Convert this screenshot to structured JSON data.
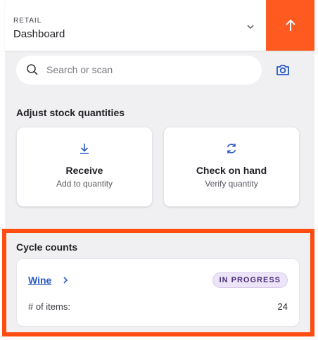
{
  "header": {
    "kicker": "RETAIL",
    "selected": "Dashboard",
    "dropdown_icon": "chevron-down-icon",
    "upload_icon": "arrow-up-icon",
    "upload_color": "#ff5a1f"
  },
  "search": {
    "placeholder": "Search or scan",
    "search_icon": "magnifier-icon",
    "scan_icon": "camera-icon"
  },
  "adjust": {
    "title": "Adjust stock quantities",
    "cards": [
      {
        "title": "Receive",
        "subtitle": "Add to quantity",
        "icon": "arrow-down-icon"
      },
      {
        "title": "Check on hand",
        "subtitle": "Verify quantity",
        "icon": "refresh-icon"
      }
    ]
  },
  "cycle": {
    "title": "Cycle counts",
    "highlight_color": "#ff4d12",
    "item": {
      "name": "Wine",
      "status": "IN PROGRESS",
      "items_label": "# of items:",
      "items_value": "24"
    }
  },
  "colors": {
    "link": "#2b59c3",
    "background": "#f0f0f3",
    "badge_bg": "#ece4f7"
  }
}
